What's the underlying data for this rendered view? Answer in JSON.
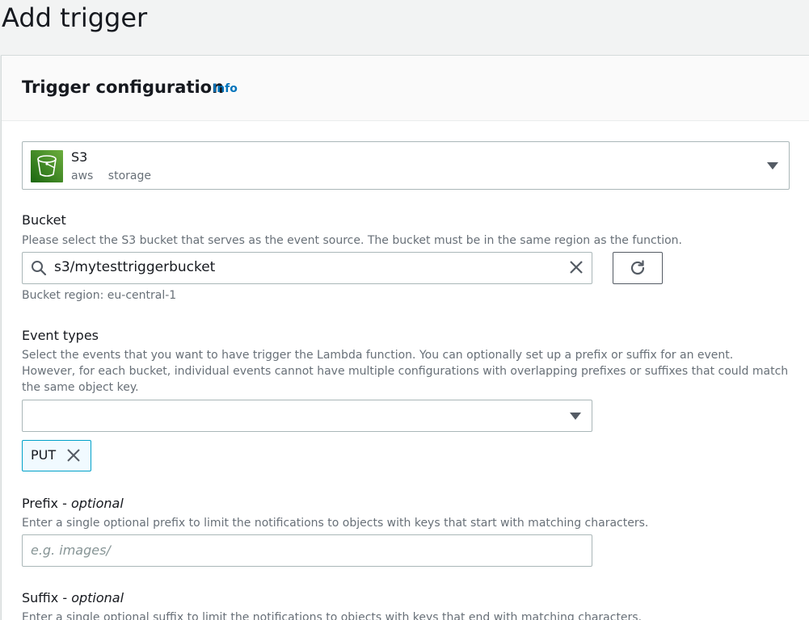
{
  "page": {
    "title": "Add trigger"
  },
  "card": {
    "title": "Trigger configuration",
    "info_link": "Info"
  },
  "service": {
    "name": "S3",
    "tags": [
      "aws",
      "storage"
    ],
    "icon": "s3-bucket-icon",
    "icon_color": "#3f8624"
  },
  "bucket": {
    "label": "Bucket",
    "description": "Please select the S3 bucket that serves as the event source. The bucket must be in the same region as the function.",
    "value": "s3/mytesttriggerbucket",
    "region_text": "Bucket region: eu-central-1"
  },
  "event_types": {
    "label": "Event types",
    "description": "Select the events that you want to have trigger the Lambda function. You can optionally set up a prefix or suffix for an event. However, for each bucket, individual events cannot have multiple configurations with overlapping prefixes or suffixes that could match the same object key.",
    "selected": [
      {
        "label": "PUT"
      }
    ]
  },
  "prefix": {
    "label": "Prefix - ",
    "label_suffix": "optional",
    "description": "Enter a single optional prefix to limit the notifications to objects with keys that start with matching characters.",
    "placeholder": "e.g. images/"
  },
  "suffix": {
    "label": "Suffix - ",
    "label_suffix": "optional",
    "description": "Enter a single optional suffix to limit the notifications to objects with keys that end with matching characters."
  },
  "colors": {
    "link": "#0073bb",
    "token_border": "#00a1c9",
    "token_background": "#f1faff",
    "border": "#aab7b8"
  }
}
